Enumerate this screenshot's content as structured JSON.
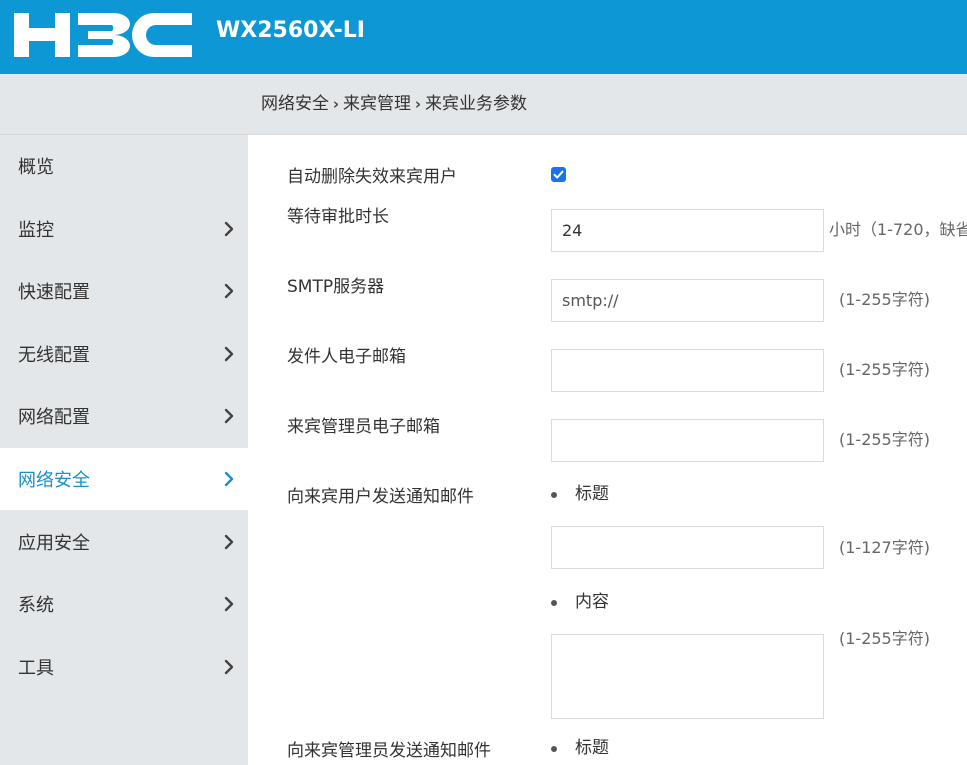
{
  "header": {
    "logo_text": "H3C",
    "model": "WX2560X-LI",
    "brand_color": "#0d97d5"
  },
  "breadcrumb": {
    "items": [
      "网络安全",
      "来宾管理",
      "来宾业务参数"
    ]
  },
  "sidebar": {
    "items": [
      {
        "label": "概览",
        "has_arrow": false,
        "active": false
      },
      {
        "label": "监控",
        "has_arrow": true,
        "active": false
      },
      {
        "label": "快速配置",
        "has_arrow": true,
        "active": false
      },
      {
        "label": "无线配置",
        "has_arrow": true,
        "active": false
      },
      {
        "label": "网络配置",
        "has_arrow": true,
        "active": false
      },
      {
        "label": "网络安全",
        "has_arrow": true,
        "active": true
      },
      {
        "label": "应用安全",
        "has_arrow": true,
        "active": false
      },
      {
        "label": "系统",
        "has_arrow": true,
        "active": false
      },
      {
        "label": "工具",
        "has_arrow": true,
        "active": false
      }
    ],
    "active_color": "#1a8fcb"
  },
  "form": {
    "auto_delete": {
      "label": "自动删除失效来宾用户",
      "checked": true
    },
    "wait_time": {
      "label": "等待审批时长",
      "value": "24",
      "hint": "小时（1-720，缺省"
    },
    "smtp": {
      "label": "SMTP服务器",
      "placeholder": "smtp://",
      "hint": "(1-255字符)"
    },
    "sender_email": {
      "label": "发件人电子邮箱",
      "value": "",
      "hint": "(1-255字符)"
    },
    "admin_email": {
      "label": "来宾管理员电子邮箱",
      "value": "",
      "hint": "(1-255字符)"
    },
    "notify_guest": {
      "label": "向来宾用户发送通知邮件",
      "subject_label": "标题",
      "subject_value": "",
      "subject_hint": "(1-127字符)",
      "body_label": "内容",
      "body_value": "",
      "body_hint": "(1-255字符)"
    },
    "notify_admin": {
      "label": "向来宾管理员发送通知邮件",
      "subject_label": "标题"
    }
  }
}
